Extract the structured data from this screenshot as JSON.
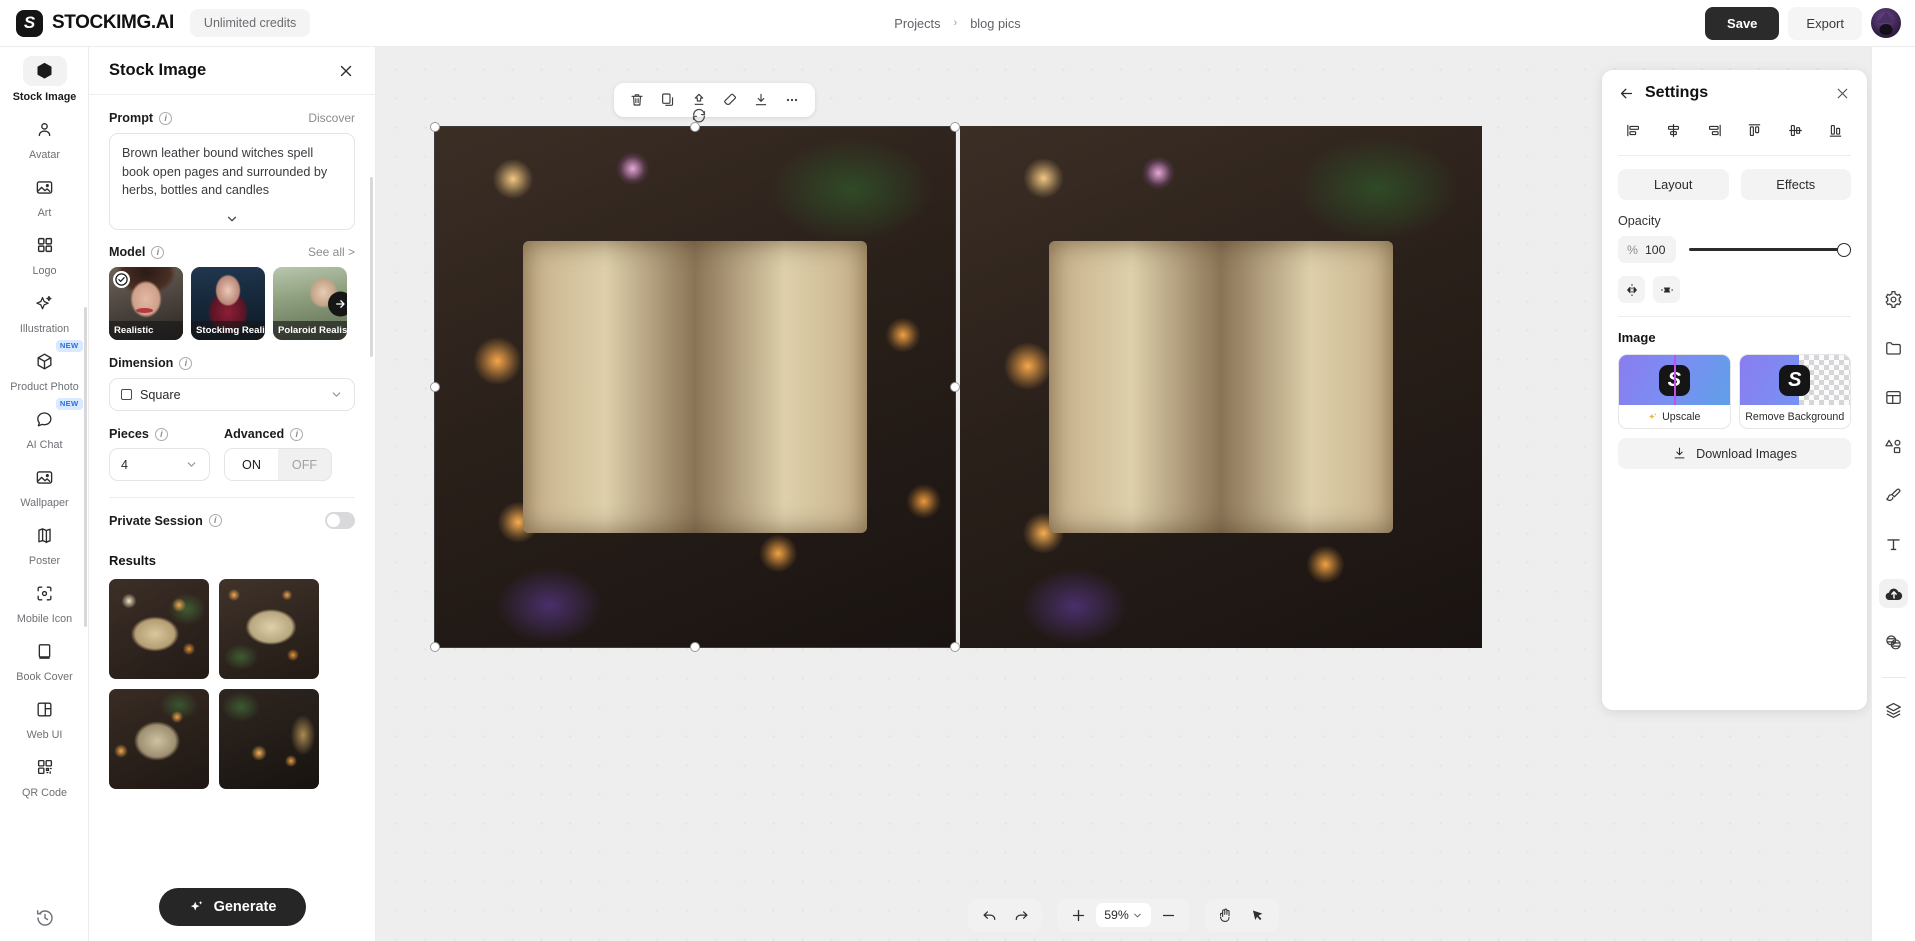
{
  "topbar": {
    "brand_name": "STOCKIMG.AI",
    "brand_mark": "S",
    "credits_label": "Unlimited credits",
    "breadcrumb": {
      "root": "Projects",
      "separator": "›",
      "current": "blog pics"
    },
    "save_label": "Save",
    "export_label": "Export"
  },
  "rail": {
    "items": [
      {
        "label": "Stock Image",
        "icon": "box-icon",
        "active": true,
        "badge": ""
      },
      {
        "label": "Avatar",
        "icon": "person-icon",
        "active": false,
        "badge": ""
      },
      {
        "label": "Art",
        "icon": "image-icon",
        "active": false,
        "badge": ""
      },
      {
        "label": "Logo",
        "icon": "grid-icon",
        "active": false,
        "badge": ""
      },
      {
        "label": "Illustration",
        "icon": "sparkle-icon",
        "active": false,
        "badge": ""
      },
      {
        "label": "Product Photo",
        "icon": "cube-icon",
        "active": false,
        "badge": "NEW"
      },
      {
        "label": "AI Chat",
        "icon": "chat-bubble-icon",
        "active": false,
        "badge": "NEW"
      },
      {
        "label": "Wallpaper",
        "icon": "image-icon",
        "active": false,
        "badge": ""
      },
      {
        "label": "Poster",
        "icon": "map-icon",
        "active": false,
        "badge": ""
      },
      {
        "label": "Mobile Icon",
        "icon": "focus-icon",
        "active": false,
        "badge": ""
      },
      {
        "label": "Book Cover",
        "icon": "book-icon",
        "active": false,
        "badge": ""
      },
      {
        "label": "Web UI",
        "icon": "layout-icon",
        "active": false,
        "badge": ""
      },
      {
        "label": "QR Code",
        "icon": "qr-icon",
        "active": false,
        "badge": ""
      }
    ],
    "history_icon": "history-icon"
  },
  "panel": {
    "title": "Stock Image",
    "close_icon": "close-icon",
    "prompt": {
      "label": "Prompt",
      "discover_label": "Discover",
      "value": "Brown leather bound witches spell book open pages and surrounded by herbs, bottles and candles",
      "expand_icon": "chevron-down-icon"
    },
    "model": {
      "label": "Model",
      "see_all_label": "See all >",
      "cards": [
        {
          "name": "Realistic",
          "selected": true
        },
        {
          "name": "Stockimg Realistic",
          "selected": false
        },
        {
          "name": "Polaroid Realistic",
          "selected": false
        }
      ],
      "next_icon": "arrow-right-icon"
    },
    "dimension": {
      "label": "Dimension",
      "value": "Square",
      "glyph": "square-icon"
    },
    "pieces": {
      "label": "Pieces",
      "value": "4"
    },
    "advanced": {
      "label": "Advanced",
      "on_label": "ON",
      "off_label": "OFF",
      "state": "OFF"
    },
    "private_session": {
      "label": "Private Session",
      "enabled": false
    },
    "results": {
      "label": "Results",
      "count": 4
    },
    "generate_label": "Generate"
  },
  "canvas": {
    "toolbar": [
      {
        "icon": "trash-icon",
        "name": "delete-button"
      },
      {
        "icon": "copy-icon",
        "name": "duplicate-button"
      },
      {
        "icon": "bring-front-icon",
        "name": "bring-to-front-button"
      },
      {
        "icon": "eraser-icon",
        "name": "eraser-button"
      },
      {
        "icon": "download-icon",
        "name": "download-button"
      },
      {
        "icon": "more-icon",
        "name": "more-options-button"
      }
    ],
    "rotate_icon": "rotate-icon"
  },
  "settings": {
    "title": "Settings",
    "back_icon": "arrow-left-icon",
    "close_icon": "close-icon",
    "align_buttons": [
      "align-left-icon",
      "align-center-horizontal-icon",
      "align-right-icon",
      "align-top-icon",
      "align-center-vertical-icon",
      "align-bottom-icon"
    ],
    "tabs": [
      {
        "label": "Layout"
      },
      {
        "label": "Effects"
      }
    ],
    "opacity": {
      "label": "Opacity",
      "unit": "%",
      "value": "100",
      "percent": 100
    },
    "transform_buttons": [
      "flip-horizontal-icon",
      "flip-vertical-icon"
    ],
    "image": {
      "label": "Image",
      "cards": [
        {
          "caption": "Upscale",
          "icon": "sparkle-icon",
          "glyph": "S"
        },
        {
          "caption": "Remove Background",
          "icon": "",
          "glyph": "S"
        }
      ],
      "download_label": "Download Images",
      "download_icon": "download-icon"
    }
  },
  "right_rail": {
    "items": [
      {
        "icon": "gear-icon",
        "name": "settings-tool",
        "active": false
      },
      {
        "icon": "folder-icon",
        "name": "assets-tool",
        "active": false
      },
      {
        "icon": "template-icon",
        "name": "templates-tool",
        "active": false
      },
      {
        "icon": "shapes-icon",
        "name": "shapes-tool",
        "active": false
      },
      {
        "icon": "brush-icon",
        "name": "brush-tool",
        "active": false
      },
      {
        "icon": "text-icon",
        "name": "text-tool",
        "active": false
      },
      {
        "icon": "upload-cloud-icon",
        "name": "upload-tool",
        "active": true
      },
      {
        "icon": "layers-stack-icon",
        "name": "effects-tool",
        "active": false
      },
      {
        "icon": "layers-icon",
        "name": "layers-tool",
        "active": false
      }
    ]
  },
  "bottom_bar": {
    "undo_icon": "undo-icon",
    "redo_icon": "redo-icon",
    "zoom_in_icon": "plus-icon",
    "zoom_out_icon": "minus-icon",
    "zoom_value": "59%",
    "zoom_chevron": "chevron-down-icon",
    "hand_icon": "hand-icon",
    "cursor_icon": "cursor-icon"
  }
}
